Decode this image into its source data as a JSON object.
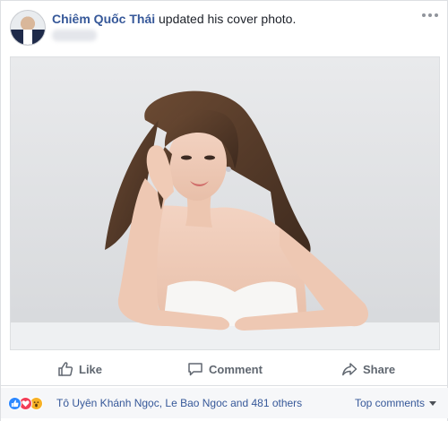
{
  "post": {
    "author": "Chiêm Quốc Thái",
    "action_text": " updated his cover photo.",
    "more_icon": "ellipsis-icon"
  },
  "photo": {
    "description_icon": "cover-photo"
  },
  "actions": {
    "like_label": "Like",
    "comment_label": "Comment",
    "share_label": "Share"
  },
  "reactions": {
    "icons": [
      "like-icon",
      "love-icon",
      "wow-icon"
    ],
    "summary": "Tô Uyên Khánh Ngọc, Le Bao Ngoc and 481 others",
    "top_comments_label": "Top comments"
  },
  "colors": {
    "link": "#365899",
    "action_text": "#606770",
    "like_blue": "#2d88ff",
    "love_red": "#f33e58",
    "wow_yellow": "#f7b125"
  }
}
